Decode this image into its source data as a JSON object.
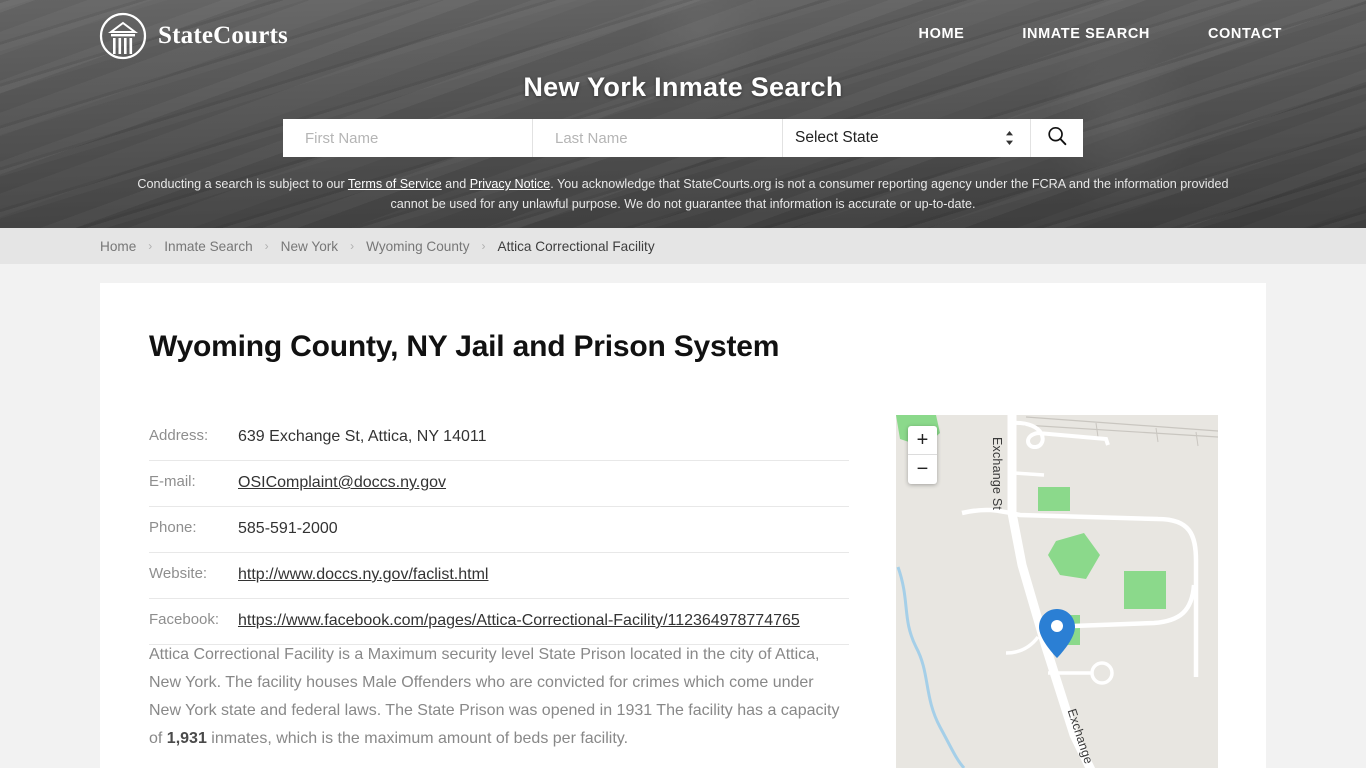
{
  "header": {
    "brand": "StateCourts",
    "logo_icon": "courthouse-circle-icon",
    "nav": [
      {
        "label": "HOME"
      },
      {
        "label": "INMATE SEARCH"
      },
      {
        "label": "CONTACT"
      }
    ],
    "hero_title": "New York Inmate Search"
  },
  "search": {
    "first_name_placeholder": "First Name",
    "first_name_value": "",
    "last_name_placeholder": "Last Name",
    "last_name_value": "",
    "state_selected": "Select State",
    "search_icon": "magnifier-icon",
    "stepper_icon": "up-down-chevron-icon"
  },
  "disclaimer": {
    "part1": "Conducting a search is subject to our ",
    "link1": "Terms of Service",
    "part2": " and ",
    "link2": "Privacy Notice",
    "part3": ". You acknowledge that StateCourts.org is not a consumer reporting agency under the FCRA and the information provided cannot be used for any unlawful purpose. We do not guarantee that information is accurate or up-to-date."
  },
  "breadcrumb": {
    "items": [
      {
        "label": "Home"
      },
      {
        "label": "Inmate Search"
      },
      {
        "label": "New York"
      },
      {
        "label": "Wyoming County"
      },
      {
        "label": "Attica Correctional Facility"
      }
    ],
    "separator": "›"
  },
  "main": {
    "page_title": "Wyoming County, NY Jail and Prison System",
    "info_rows": [
      {
        "label": "Address:",
        "value": "639 Exchange St, Attica, NY 14011",
        "is_link": false
      },
      {
        "label": "E-mail:",
        "value": "OSIComplaint@doccs.ny.gov",
        "is_link": true
      },
      {
        "label": "Phone:",
        "value": "585-591-2000",
        "is_link": false
      },
      {
        "label": "Website:",
        "value": "http://www.doccs.ny.gov/faclist.html",
        "is_link": true
      },
      {
        "label": "Facebook:",
        "value": "https://www.facebook.com/pages/Attica-Correctional-Facility/112364978774765",
        "is_link": true
      }
    ],
    "description_pre": "Attica Correctional Facility is a Maximum security level State Prison located in the city of Attica, New York. The facility houses Male Offenders who are convicted for crimes which come under New York state and federal laws. The State Prison was opened in 1931 The facility has a capacity of ",
    "description_capacity": "1,931",
    "description_post": " inmates, which is the maximum amount of beds per facility."
  },
  "map": {
    "zoom_in_label": "+",
    "zoom_out_label": "−",
    "street_label_vertical": "Exchange St",
    "street_label_diagonal": "Exchange",
    "marker_icon": "map-pin-icon",
    "colors": {
      "land": "#e8e6e1",
      "park": "#8bd98b",
      "road": "#ffffff",
      "water": "#a5cfe8",
      "marker": "#2b7fd4"
    }
  }
}
